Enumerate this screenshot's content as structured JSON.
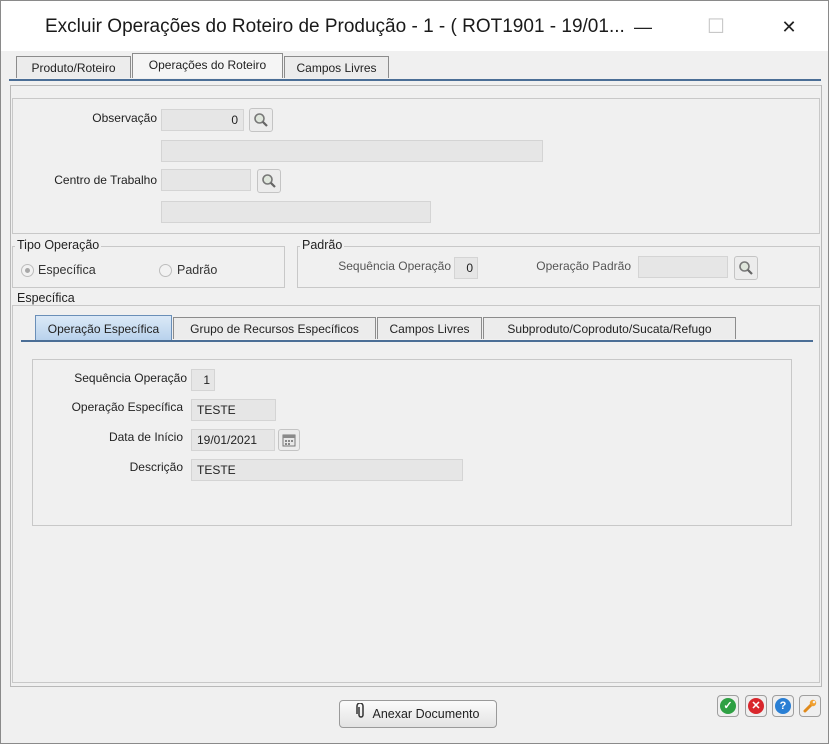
{
  "window": {
    "title": "Excluir Operações do Roteiro de Produção - 1 - ( ROT1901 - 19/01...",
    "minimize_glyph": "—",
    "maximize_glyph": "☐",
    "close_glyph": "✕"
  },
  "main_tabs": [
    {
      "label": "Produto/Roteiro"
    },
    {
      "label": "Operações do Roteiro",
      "active": true
    },
    {
      "label": "Campos Livres"
    }
  ],
  "top_section": {
    "observacao_label": "Observação",
    "observacao_value": "0",
    "observacao_desc": "",
    "centro_label": "Centro de Trabalho",
    "centro_value": "",
    "centro_desc": ""
  },
  "tipo_operacao": {
    "legend": "Tipo Operação",
    "options": [
      {
        "label": "Específica",
        "selected": true
      },
      {
        "label": "Padrão",
        "selected": false
      }
    ]
  },
  "padrao": {
    "legend": "Padrão",
    "seq_label": "Sequência Operação",
    "seq_value": "0",
    "op_label": "Operação Padrão",
    "op_value": ""
  },
  "especifica": {
    "legend": "Específica",
    "tabs": [
      {
        "label": "Operação Específica",
        "active": true
      },
      {
        "label": "Grupo de Recursos Específicos"
      },
      {
        "label": "Campos Livres"
      },
      {
        "label": "Subproduto/Coproduto/Sucata/Refugo"
      }
    ],
    "fields": {
      "seq_label": "Sequência Operação",
      "seq_value": "1",
      "op_label": "Operação Específica",
      "op_value": "TESTE",
      "date_label": "Data de Início",
      "date_value": "19/01/2021",
      "desc_label": "Descrição",
      "desc_value": "TESTE"
    }
  },
  "footer": {
    "attach_label": "Anexar Documento",
    "icons": {
      "confirm": "check-icon",
      "cancel": "close-icon",
      "help": "help-icon",
      "settings": "wrench-icon"
    },
    "colors": {
      "confirm": "#2ea043",
      "cancel": "#d9262c",
      "help": "#2a7fd4",
      "settings": "#f0a030"
    }
  }
}
